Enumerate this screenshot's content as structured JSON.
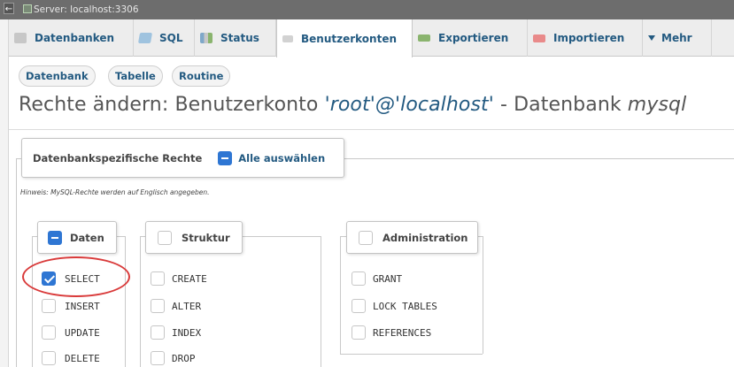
{
  "window": {
    "server_title": "Server: localhost:3306",
    "back_glyph": "←"
  },
  "tabs": [
    {
      "label": "Datenbanken",
      "icon": "database-icon",
      "active": false
    },
    {
      "label": "SQL",
      "icon": "sql-icon",
      "active": false
    },
    {
      "label": "Status",
      "icon": "status-icon",
      "active": false
    },
    {
      "label": "Benutzerkonten",
      "icon": "user-accounts-icon",
      "active": true
    },
    {
      "label": "Exportieren",
      "icon": "export-icon",
      "active": false
    },
    {
      "label": "Importieren",
      "icon": "import-icon",
      "active": false
    },
    {
      "label": "Mehr",
      "icon": "caret-down-icon",
      "active": false
    }
  ],
  "subtabs": [
    "Datenbank",
    "Tabelle",
    "Routine"
  ],
  "heading": {
    "prefix": "Rechte ändern: Benutzerkonto ",
    "account": "'root'@'localhost'",
    "middle": " - Datenbank ",
    "database": "mysql"
  },
  "rights_section": {
    "legend": "Datenbankspezifische Rechte",
    "select_all_label": "Alle auswählen",
    "hint": "Hinweis: MySQL-Rechte werden auf Englisch angegeben."
  },
  "groups": [
    {
      "title": "Daten",
      "state": "partial",
      "items": [
        {
          "label": "SELECT",
          "checked": true
        },
        {
          "label": "INSERT",
          "checked": false
        },
        {
          "label": "UPDATE",
          "checked": false
        },
        {
          "label": "DELETE",
          "checked": false
        }
      ]
    },
    {
      "title": "Struktur",
      "state": "unchecked",
      "items": [
        {
          "label": "CREATE",
          "checked": false
        },
        {
          "label": "ALTER",
          "checked": false
        },
        {
          "label": "INDEX",
          "checked": false
        },
        {
          "label": "DROP",
          "checked": false
        }
      ]
    },
    {
      "title": "Administration",
      "state": "unchecked",
      "items": [
        {
          "label": "GRANT",
          "checked": false
        },
        {
          "label": "LOCK TABLES",
          "checked": false
        },
        {
          "label": "REFERENCES",
          "checked": false
        }
      ]
    }
  ],
  "colors": {
    "accent": "#235a81",
    "checkbox_blue": "#2e76d3",
    "highlight_red": "#d93a3a",
    "server_bar": "#6d6d6d"
  }
}
